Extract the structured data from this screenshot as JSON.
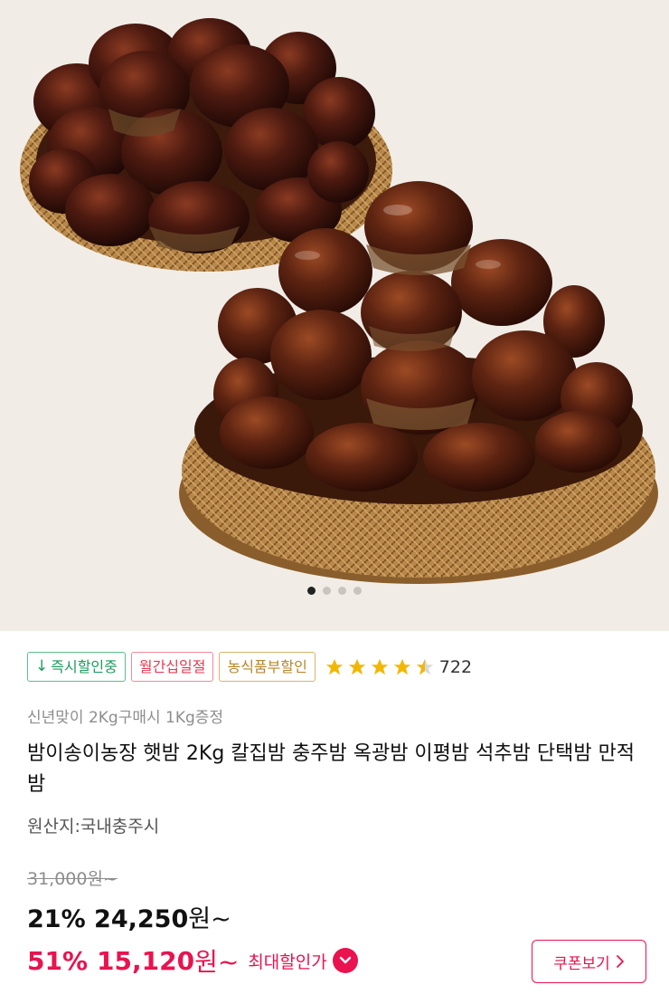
{
  "image": {
    "alt": "chestnuts-in-woven-baskets",
    "carousel_total": 4,
    "carousel_active": 1
  },
  "badges": {
    "instant": "즉시할인중",
    "monthly": "월간십일절",
    "agri": "농식품부할인"
  },
  "rating": {
    "stars": 4.5,
    "count": "722"
  },
  "promo_text": "신년맞이 2Kg구매시 1Kg증정",
  "product_title": "밤이송이농장 햇밤 2Kg 칼집밤 충주밤 옥광밤 이평밤 석추밤 단택밤 만적밤",
  "origin": "원산지:국내충주시",
  "price": {
    "original": "31,000원~",
    "sale_pct": "21%",
    "sale_price": "24,250",
    "sale_unit": "원~",
    "max_pct": "51%",
    "max_price": "15,120",
    "max_unit": "원~",
    "max_label": "최대할인가"
  },
  "coupon_button": "쿠폰보기",
  "colors": {
    "accent": "#e8134f",
    "star": "#f2b705",
    "instant": "#1c9a5e",
    "monthly": "#e63a52",
    "agri": "#b8862a"
  }
}
